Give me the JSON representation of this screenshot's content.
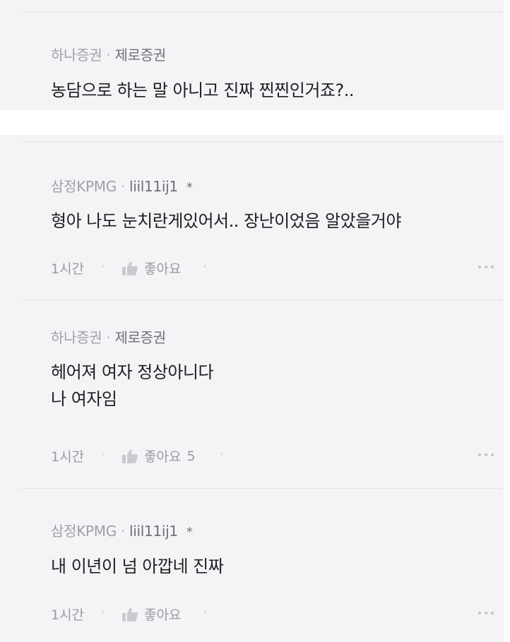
{
  "comments": [
    {
      "company": "하나증권",
      "user": "제로증권",
      "lines": [
        "농담으로 하는 말 아니고 진짜 찐찐인거죠?.."
      ]
    },
    {
      "company": "삼정KPMG",
      "user": "liil11ij1",
      "star": "*",
      "lines": [
        "형아 나도 눈치란게있어서.. 장난이었음 알았을거야"
      ],
      "time": "1시간",
      "like_label": "좋아요",
      "like_count": ""
    },
    {
      "company": "하나증권",
      "user": "제로증권",
      "lines": [
        "헤어져 여자 정상아니다",
        "나 여자임"
      ],
      "time": "1시간",
      "like_label": "좋아요",
      "like_count": "5"
    },
    {
      "company": "삼정KPMG",
      "user": "liil11ij1",
      "star": "*",
      "lines": [
        "내 이년이 넘 아깝네 진짜"
      ],
      "time": "1시간",
      "like_label": "좋아요",
      "like_count": ""
    }
  ],
  "separator": "·",
  "icons": {
    "like": "thumbs-up-icon",
    "more": "more-dots-icon"
  },
  "colors": {
    "background": "#f4f4f7",
    "text": "#1e1e22",
    "meta": "#8f8f96"
  }
}
